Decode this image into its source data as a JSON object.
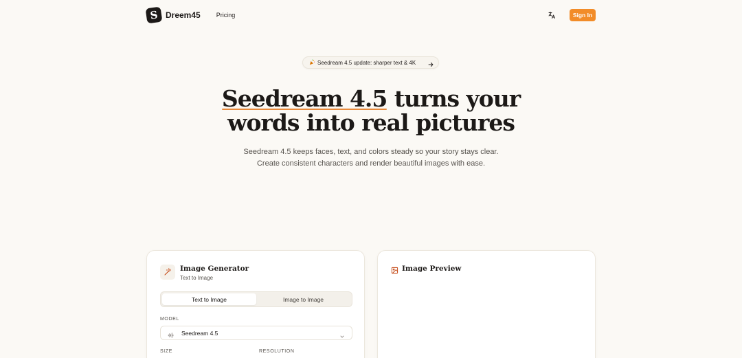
{
  "header": {
    "brand": "Dreem45",
    "logo_letter": "S",
    "nav_pricing": "Pricing",
    "lang_icon": "translate-icon",
    "signin_label": "Sign In"
  },
  "announcement": {
    "text": "Seedream 4.5 update: sharper text & 4K",
    "icon": "party-popper-icon",
    "arrow_icon": "arrow-right-icon"
  },
  "hero": {
    "title_highlight": "Seedream 4.5",
    "title_rest_line1": " turns your",
    "title_line2": "words into real pictures",
    "subtitle": "Seedream 4.5 keeps faces, text, and colors steady so your story stays clear. Create consistent characters and render beautiful images with ease."
  },
  "generator": {
    "title": "Image Generator",
    "subtitle": "Text to Image",
    "tabs": [
      {
        "label": "Text to Image",
        "active": true
      },
      {
        "label": "Image to Image",
        "active": false
      }
    ],
    "model_label": "MODEL",
    "model_value": "Seedream 4.5",
    "size_label": "SIZE",
    "resolution_label": "RESOLUTION"
  },
  "preview": {
    "title": "Image Preview"
  },
  "colors": {
    "accent": "#f28c28",
    "background": "#fbf9f5",
    "text": "#1c1917"
  }
}
